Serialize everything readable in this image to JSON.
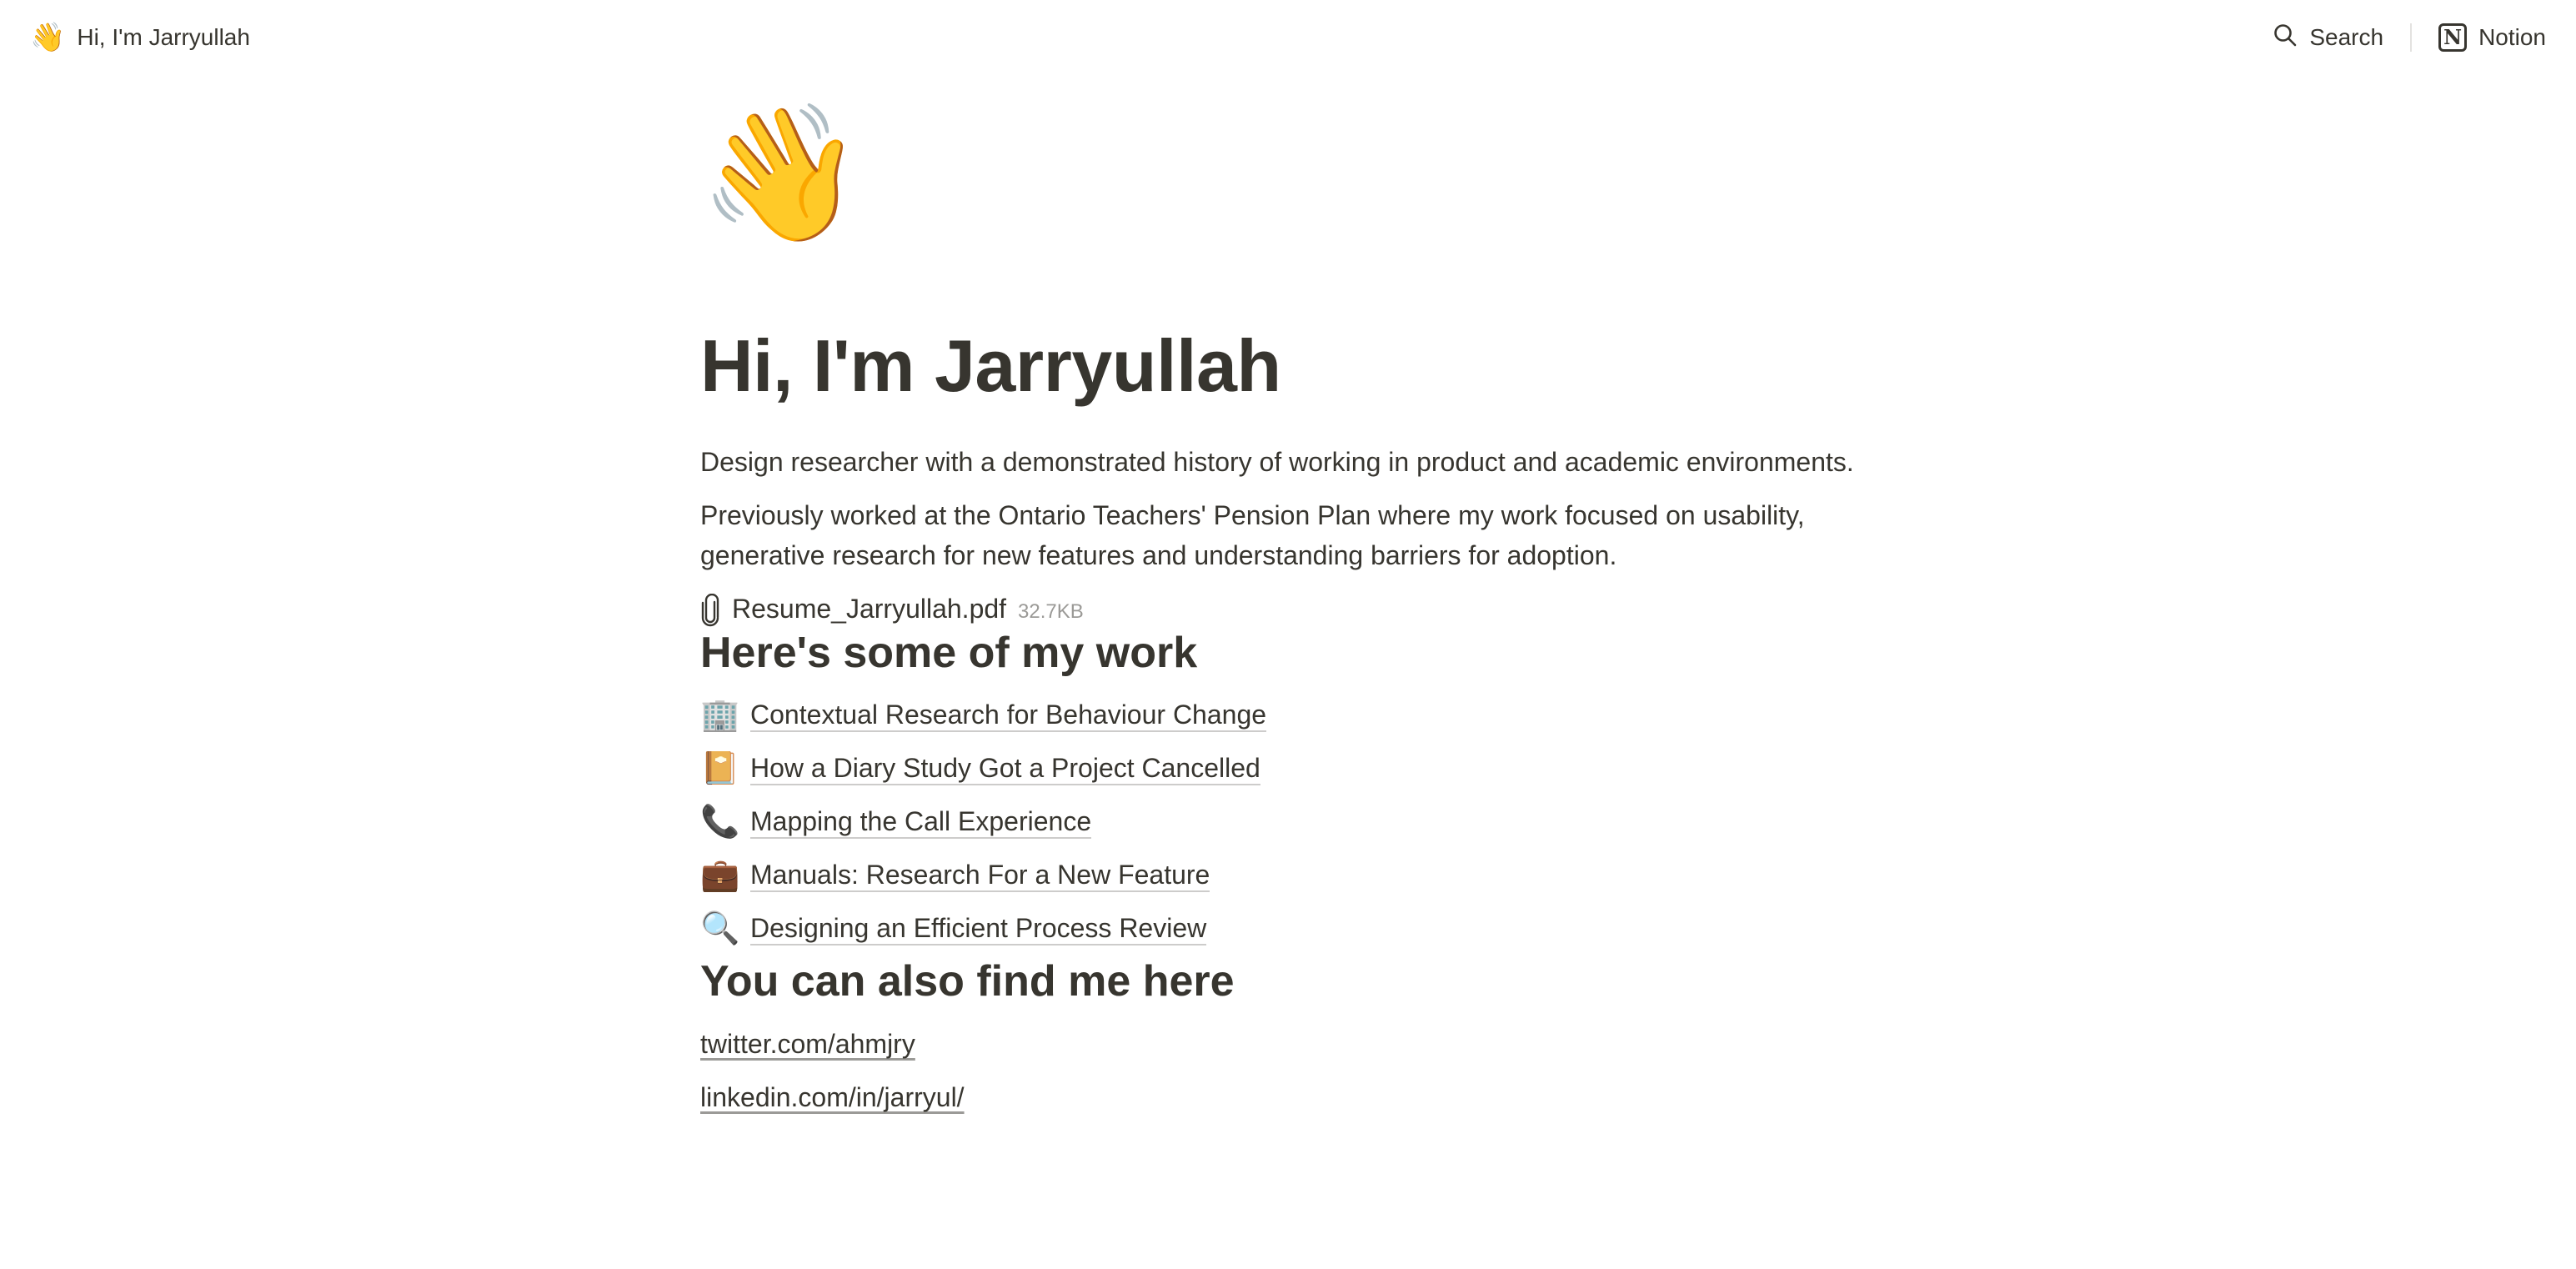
{
  "topbar": {
    "breadcrumb_icon": "👋",
    "breadcrumb_label": "Hi, I'm Jarryullah",
    "search_label": "Search",
    "notion_label": "Notion",
    "notion_logo_letter": "N"
  },
  "page": {
    "icon": "👋",
    "title": "Hi, I'm Jarryullah",
    "paragraphs": [
      "Design researcher with a demonstrated history of working in product and academic environments.",
      "Previously worked at the Ontario Teachers' Pension Plan where my work focused on usability, generative research for new features and understanding barriers for adoption."
    ],
    "file": {
      "name": "Resume_Jarryullah.pdf",
      "size": "32.7KB"
    },
    "work_heading": "Here's some of my work",
    "work_items": [
      {
        "icon": "🏢",
        "label": "Contextual Research for Behaviour Change"
      },
      {
        "icon": "📔",
        "label": "How a Diary Study Got a Project Cancelled"
      },
      {
        "icon": "📞",
        "label": "Mapping the Call Experience"
      },
      {
        "icon": "💼",
        "label": "Manuals: Research For a New Feature"
      },
      {
        "icon": "🔍",
        "label": "Designing an Efficient Process Review"
      }
    ],
    "find_heading": "You can also find me here",
    "links": [
      "twitter.com/ahmjry",
      "linkedin.com/in/jarryul/"
    ]
  },
  "colors": {
    "text": "#37352f",
    "muted": "#9b9a97",
    "background": "#ffffff"
  }
}
